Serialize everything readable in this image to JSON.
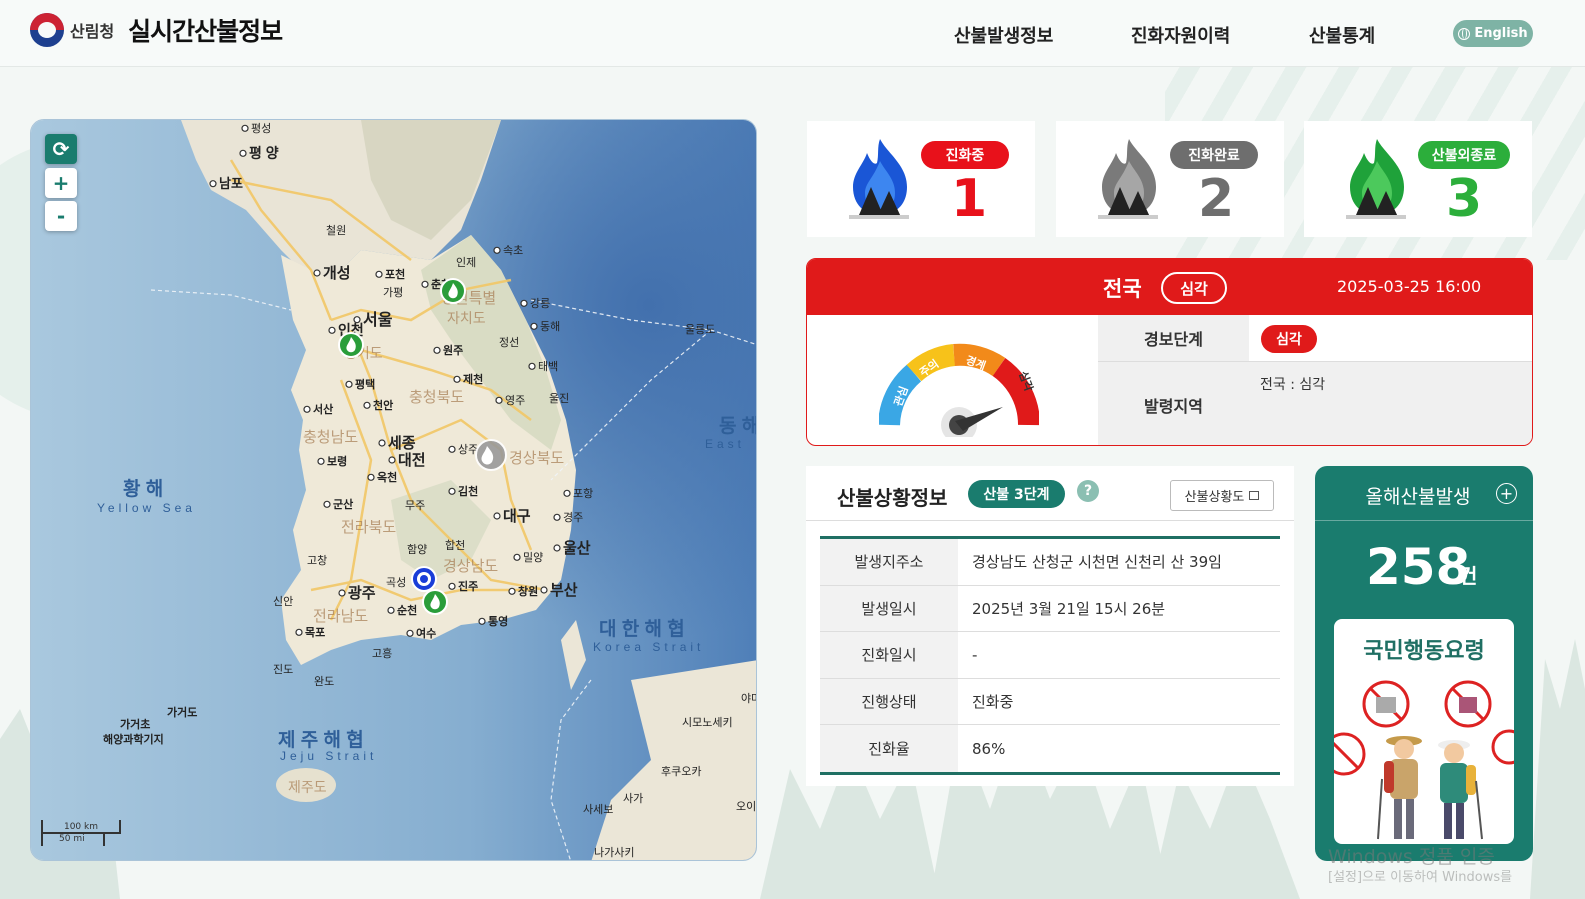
{
  "header": {
    "org": "산림청",
    "title": "실시간산불정보",
    "nav": [
      "산불발생정보",
      "진화자원이력",
      "산불통계"
    ],
    "lang_button": "English"
  },
  "map": {
    "zoom_in": "+",
    "zoom_out": "-",
    "scale_km": "100 km",
    "scale_mi": "50 mi",
    "labels": {
      "pyeongseong": "평성",
      "pyeongyang": "평 양",
      "nampo": "남포",
      "cheorwon": "철원",
      "kaesong": "개성",
      "pocheon": "포천",
      "chuncheon": "춘천",
      "inje": "인제",
      "sokcho": "속초",
      "gapyeong": "가평",
      "seoul": "서울",
      "incheon": "인천",
      "gangneung": "강릉",
      "gangwon": "강원특별",
      "gangwon2": "자치도",
      "donghae": "동해",
      "ulleungdo": "울릉도",
      "wonju": "원주",
      "jeongseon": "정선",
      "taebaek": "태백",
      "gyeonggi": "경기도",
      "pyeongtaek": "평택",
      "jecheon": "제천",
      "seosan": "서산",
      "cheonan": "천안",
      "chungbuk": "충청북도",
      "yeongju": "영주",
      "uljin": "울진",
      "chungnam": "충청남도",
      "sejong": "세종",
      "sangju": "상주",
      "daejeon": "대전",
      "gyeongbuk": "경상북도",
      "boryeong": "보령",
      "okcheon": "옥천",
      "gimcheon": "김천",
      "pohang": "포항",
      "gunsan": "군산",
      "muju": "무주",
      "daegu": "대구",
      "gyeongju": "경주",
      "jeonbuk": "전라북도",
      "hapcheon": "합천",
      "hamyang": "함양",
      "miryang": "밀양",
      "ulsan": "울산",
      "gochang": "고창",
      "gyeongnam": "경상남도",
      "gokseong": "곡성",
      "gwangju": "광주",
      "jinju": "진주",
      "changwon": "창원",
      "busan": "부산",
      "shinan": "신안",
      "jeonnam": "전라남도",
      "suncheon": "순천",
      "tongyeong": "통영",
      "mokpo": "목포",
      "yeosu": "여수",
      "jindo": "진도",
      "goheung": "고흥",
      "wando": "완도",
      "gageodo": "가거도",
      "gageocho": "가거초",
      "gageocho2": "해양과학기지",
      "jeju": "제주도",
      "yellow_sea": "황 해",
      "yellow_sea_en": "Yellow Sea",
      "east_sea": "동 해",
      "east_sea_en": "East",
      "korea_strait": "대 한 해 협",
      "korea_strait_en": "Korea Strait",
      "jeju_strait": "제 주 해 협",
      "jeju_strait_en": "Jeju Strait",
      "shimonoseki": "시모노세키",
      "fukuoka": "후쿠오카",
      "saga": "사가",
      "sasebo": "사세보",
      "nagasaki": "나가사키",
      "o": "오이",
      "ya": "야마"
    }
  },
  "stats": [
    {
      "label": "진화중",
      "count": "1",
      "color": "#e8111b",
      "icon": "blue-fire-icon"
    },
    {
      "label": "진화완료",
      "count": "2",
      "color": "#6e6e6e",
      "icon": "gray-fire-icon"
    },
    {
      "label": "산불외종료",
      "count": "3",
      "color": "#2cae3b",
      "icon": "green-fire-icon"
    }
  ],
  "alert": {
    "region": "전국",
    "level": "심각",
    "datetime": "2025-03-25 16:00",
    "gauge_labels": [
      "관심",
      "주의",
      "경계",
      "심각"
    ],
    "stage_label": "경보단계",
    "stage_value": "심각",
    "area_label": "발령지역",
    "area_value": "전국 : 심각"
  },
  "situation": {
    "title": "산불상황정보",
    "stage": "산불 3단계",
    "help": "?",
    "map_button": "산불상황도",
    "rows": [
      {
        "label": "발생지주소",
        "value": "경상남도 산청군 시천면 신천리 산 39임"
      },
      {
        "label": "발생일시",
        "value": "2025년 3월 21일 15시 26분"
      },
      {
        "label": "진화일시",
        "value": "-"
      },
      {
        "label": "진행상태",
        "value": "진화중"
      },
      {
        "label": "진화율",
        "value": "86%"
      }
    ]
  },
  "yearly": {
    "title": "올해산불발생",
    "count": "258",
    "unit": "건",
    "action_title": "국민행동요령"
  },
  "watermark": {
    "line1": "Windows 정품 인증",
    "line2": "[설정]으로 이동하여 Windows를"
  }
}
